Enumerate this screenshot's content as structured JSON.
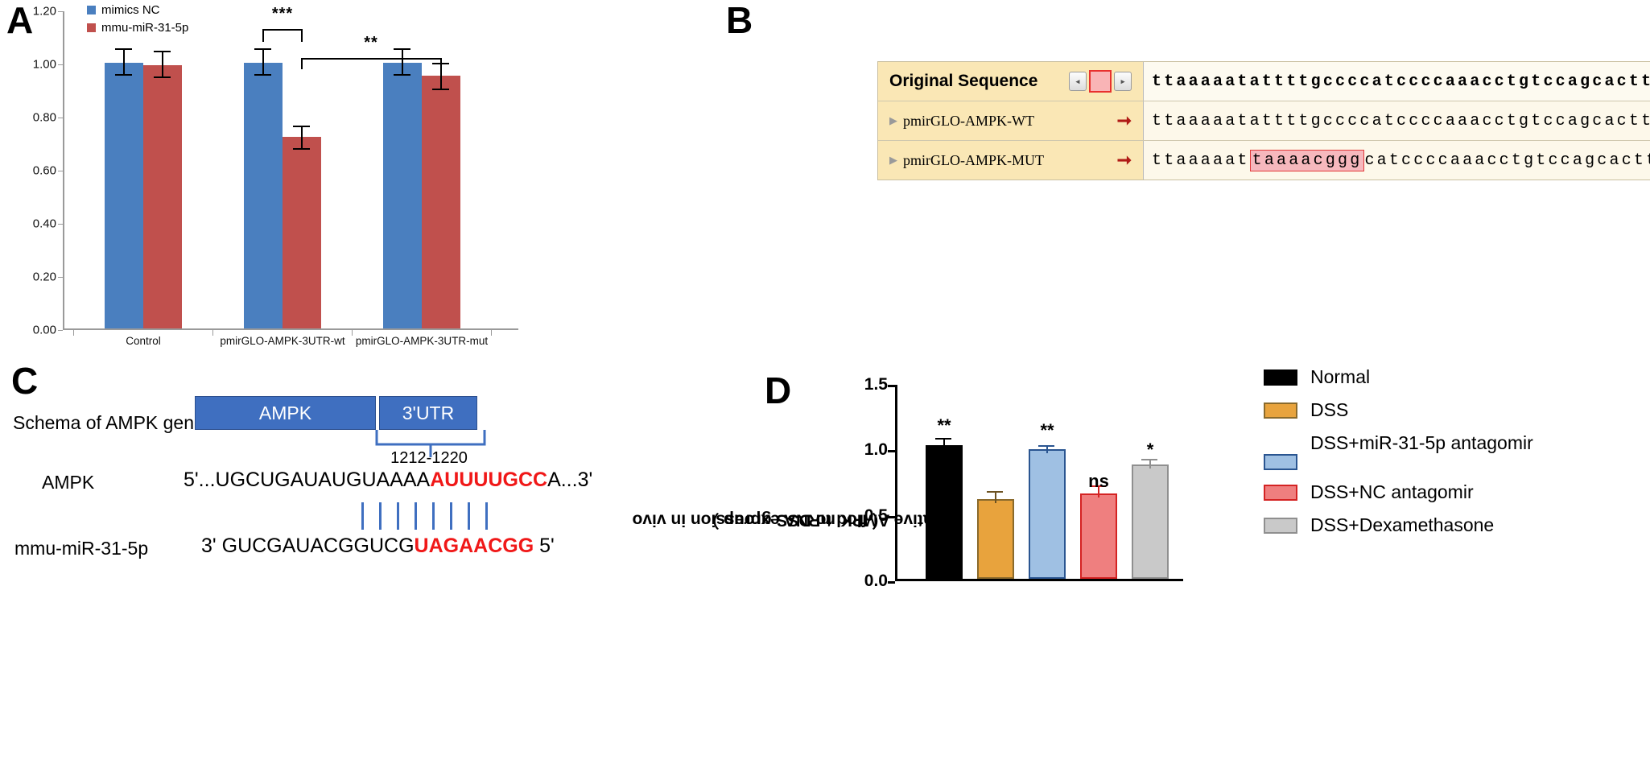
{
  "panel_a": {
    "letter": "A",
    "legend": [
      {
        "label": "mimics NC",
        "color": "#4a7fbf"
      },
      {
        "label": "mmu-miR-31-5p",
        "color": "#c0504d"
      }
    ],
    "chart_data": {
      "type": "bar",
      "title": "",
      "xlabel": "",
      "ylabel": "",
      "ylim": [
        0.0,
        1.2
      ],
      "yticks": [
        "0.00",
        "0.20",
        "0.40",
        "0.60",
        "0.80",
        "1.00",
        "1.20"
      ],
      "categories": [
        "Control",
        "pmirGLO-AMPK-3UTR-wt",
        "pmirGLO-AMPK-3UTR-mut"
      ],
      "series": [
        {
          "name": "mimics NC",
          "color": "#4a7fbf",
          "values": [
            1.0,
            1.0,
            1.0
          ],
          "errors": [
            0.05,
            0.05,
            0.05
          ]
        },
        {
          "name": "mmu-miR-31-5p",
          "color": "#c0504d",
          "values": [
            0.99,
            0.72,
            0.95
          ],
          "errors": [
            0.05,
            0.04,
            0.05
          ]
        }
      ],
      "grid": false,
      "legend_position": "top-left"
    },
    "significance": [
      {
        "label": "***",
        "note": "between wt mimics-NC and wt mmu-miR-31-5p"
      },
      {
        "label": "**",
        "note": "between wt mmu-miR-31-5p and mut mmu-miR-31-5p"
      }
    ]
  },
  "panel_b": {
    "letter": "B",
    "header_label": "Original Sequence",
    "nav": {
      "prev": "◂",
      "next": "▸"
    },
    "rows": [
      {
        "name": "",
        "is_header": true,
        "sequence_prefix": "ttaaaaatattttgccccatccccaaacctgtccagcactt",
        "mutation": "",
        "sequence_suffix": ""
      },
      {
        "name": "pmirGLO-AMPK-WT",
        "is_header": false,
        "sequence_prefix": "ttaaaaatattttgccccatccccaaacctgtccagcactt",
        "mutation": "",
        "sequence_suffix": ""
      },
      {
        "name": "pmirGLO-AMPK-MUT",
        "is_header": false,
        "sequence_prefix": "ttaaaaat",
        "mutation": "taaaacggg",
        "sequence_suffix": "catccccaaacctgtccagcactt"
      }
    ]
  },
  "panel_c": {
    "letter": "C",
    "schema_label": "Schema of AMPK gene",
    "gene_box": "AMPK",
    "utr_box": "3'UTR",
    "coordinate": "1212-1220",
    "rows": [
      {
        "label": "AMPK",
        "end5": "5'...UGCUGAUAUGUAAAA",
        "seed": "AUUUUGCC",
        "tail": "A...3'"
      },
      {
        "label": "mmu-miR-31-5p",
        "end5": "3'  GUCGAUACGGUCG",
        "seed": "UAGAACGG",
        "tail": "  5'"
      }
    ],
    "pair_count": 8
  },
  "panel_d": {
    "letter": "D",
    "y_axis_title": "Relative AMPK mRNA expression in vivo\n（flod to DSS group）",
    "y_axis_title_line1": "Relative AMPK mRNA expression in vivo",
    "y_axis_title_line2": "（ flod to DSS group ）",
    "chart_data": {
      "type": "bar",
      "title": "",
      "xlabel": "",
      "ylabel": "Relative AMPK mRNA expression in vivo ( flod to DSS group )",
      "ylim": [
        0.0,
        1.5
      ],
      "yticks": [
        "0.0",
        "0.5",
        "1.0",
        "1.5"
      ],
      "categories": [
        "Normal",
        "DSS",
        "DSS+miR-31-5p antagomir",
        "DSS+NC antagomir",
        "DSS+Dexamethasone"
      ],
      "values": [
        1.02,
        0.61,
        0.99,
        0.65,
        0.87
      ],
      "errors": [
        0.04,
        0.04,
        0.02,
        0.04,
        0.03
      ],
      "colors": [
        "#000000",
        "#e8a33d",
        "#9fc0e3",
        "#ef7f7f",
        "#c9c9c9"
      ],
      "border_colors": [
        "#000000",
        "#8a6a2c",
        "#2a5591",
        "#d42323",
        "#8f8f8f"
      ],
      "significance": [
        "**",
        "",
        "**",
        "ns",
        "*"
      ],
      "grid": false,
      "legend_position": "right"
    },
    "legend": [
      {
        "label": "Normal",
        "color": "#000000",
        "border": "#000000"
      },
      {
        "label": "DSS",
        "color": "#e8a33d",
        "border": "#8a6a2c"
      },
      {
        "label": "DSS+miR-31-5p antagomir",
        "color": "#9fc0e3",
        "border": "#2a5591"
      },
      {
        "label": "DSS+NC antagomir",
        "color": "#ef7f7f",
        "border": "#d42323"
      },
      {
        "label": "DSS+Dexamethasone",
        "color": "#c9c9c9",
        "border": "#8f8f8f"
      }
    ]
  }
}
